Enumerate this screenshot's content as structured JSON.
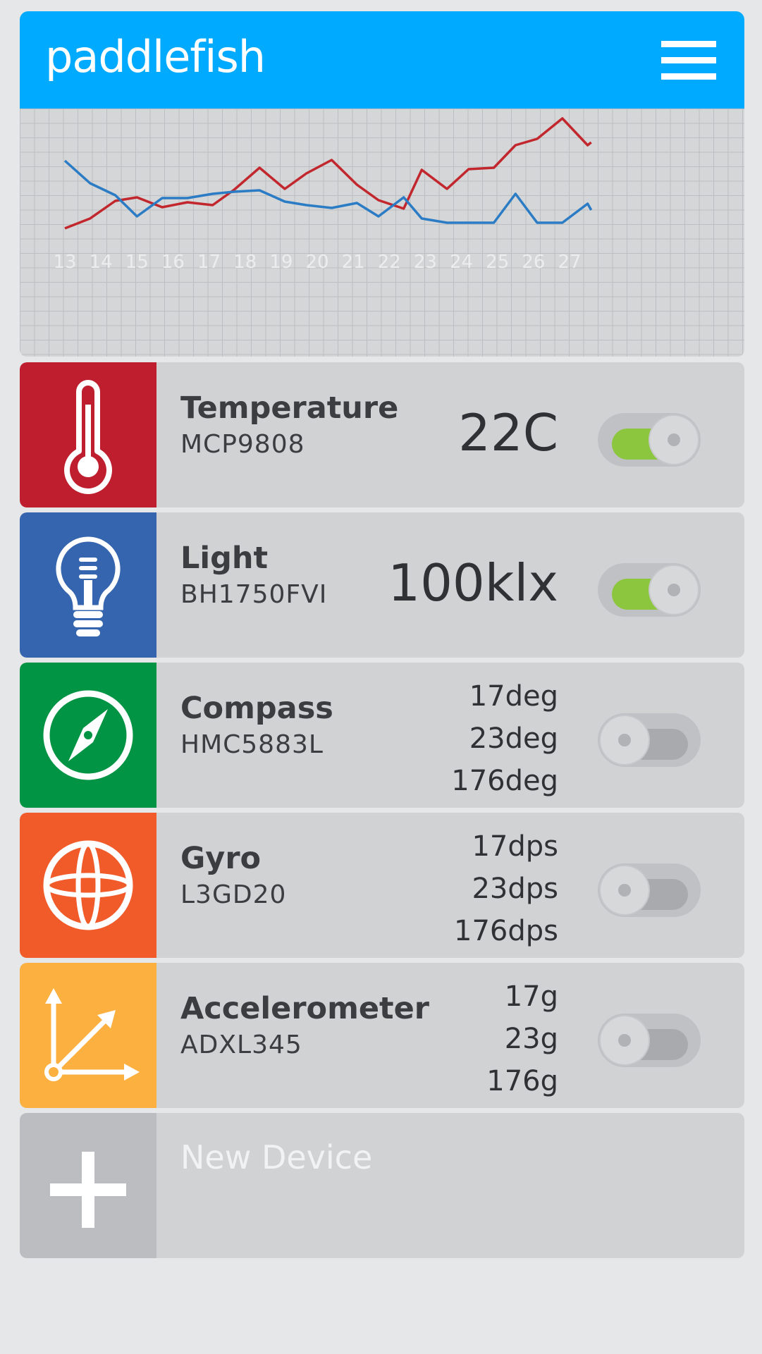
{
  "app": {
    "title": "paddlefish"
  },
  "chart_data": {
    "type": "line",
    "x": [
      13,
      14,
      15,
      16,
      17,
      18,
      19,
      20,
      21,
      22,
      23,
      24,
      25,
      26,
      27
    ],
    "x_tick_labels": [
      "13",
      "14",
      "15",
      "16",
      "17",
      "18",
      "19",
      "20",
      "21",
      "22",
      "23",
      "24",
      "25",
      "26",
      "27"
    ],
    "grid": true,
    "series": [
      {
        "color": "#c1272d",
        "values": [
          312,
          298,
          273,
          268,
          282,
          275,
          279,
          257,
          226,
          256,
          234,
          215,
          250,
          272,
          284,
          229,
          256,
          228,
          226,
          194,
          185,
          156,
          194,
          190
        ],
        "x_points": [
          13.0,
          13.7,
          14.4,
          15.0,
          15.7,
          16.4,
          17.1,
          17.7,
          18.4,
          19.1,
          19.7,
          20.4,
          21.1,
          21.7,
          22.4,
          22.9,
          23.6,
          24.2,
          24.9,
          25.5,
          26.1,
          26.8,
          27.5,
          27.6
        ]
      },
      {
        "color": "#2b7cc4",
        "values": [
          216,
          248,
          265,
          295,
          269,
          269,
          263,
          260,
          258,
          274,
          279,
          283,
          276,
          295,
          268,
          298,
          304,
          304,
          304,
          263,
          304,
          304,
          277,
          286
        ],
        "x_points": [
          13.0,
          13.7,
          14.4,
          15.0,
          15.7,
          16.4,
          17.1,
          17.7,
          18.4,
          19.1,
          19.7,
          20.4,
          21.1,
          21.7,
          22.4,
          22.9,
          23.6,
          24.2,
          24.9,
          25.5,
          26.1,
          26.8,
          27.5,
          27.6
        ]
      }
    ]
  },
  "devices": [
    {
      "name": "Temperature",
      "model": "MCP9808",
      "value": "22C",
      "enabled": true,
      "tile_color": "#be1e2d",
      "icon": "thermometer-icon"
    },
    {
      "name": "Light",
      "model": "BH1750FVI",
      "value": "100klx",
      "enabled": true,
      "tile_color": "#3465ae",
      "icon": "lightbulb-icon"
    },
    {
      "name": "Compass",
      "model": "HMC5883L",
      "values": [
        "17deg",
        "23deg",
        "176deg"
      ],
      "enabled": false,
      "tile_color": "#009444",
      "icon": "compass-icon"
    },
    {
      "name": "Gyro",
      "model": "L3GD20",
      "values": [
        "17dps",
        "23dps",
        "176dps"
      ],
      "enabled": false,
      "tile_color": "#f15a29",
      "icon": "gyroscope-icon"
    },
    {
      "name": "Accelerometer",
      "model": "ADXL345",
      "values": [
        "17g",
        "23g",
        "176g"
      ],
      "enabled": false,
      "tile_color": "#fbb040",
      "icon": "axes-icon"
    }
  ],
  "new_device": {
    "label": "New Device",
    "tile_color": "#bcbdc0",
    "icon": "plus-icon"
  }
}
